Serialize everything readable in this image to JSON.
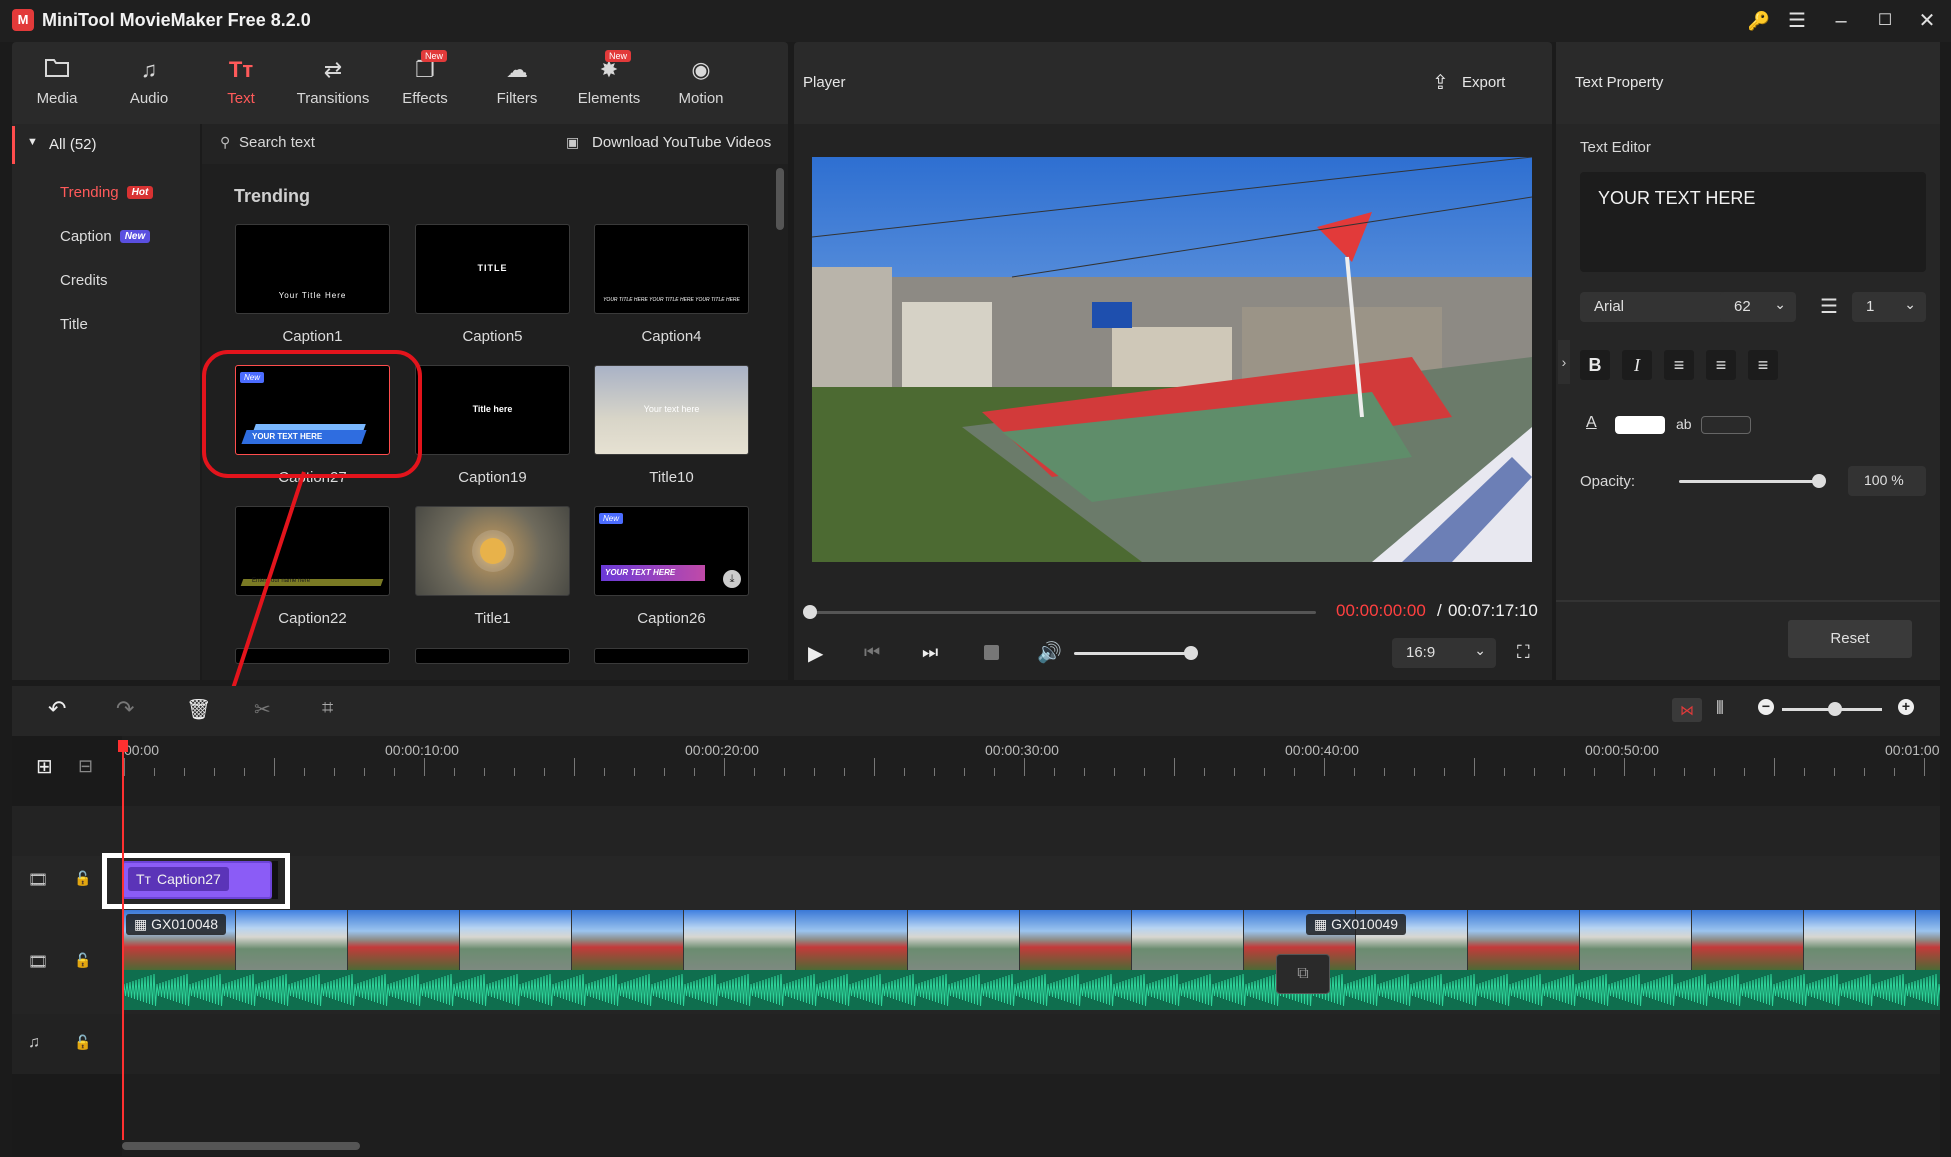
{
  "app": {
    "title": "MiniTool MovieMaker Free 8.2.0"
  },
  "toolbar": {
    "tabs": [
      {
        "label": "Media",
        "icon": "folder-icon"
      },
      {
        "label": "Audio",
        "icon": "music-icon"
      },
      {
        "label": "Text",
        "icon": "text-icon",
        "active": true
      },
      {
        "label": "Transitions",
        "icon": "transitions-icon"
      },
      {
        "label": "Effects",
        "icon": "effects-icon",
        "badge": "New"
      },
      {
        "label": "Filters",
        "icon": "filters-icon"
      },
      {
        "label": "Elements",
        "icon": "elements-icon",
        "badge": "New"
      },
      {
        "label": "Motion",
        "icon": "motion-icon"
      }
    ]
  },
  "sidebar": {
    "all_label": "All (52)",
    "items": [
      {
        "label": "Trending",
        "tag": "Hot",
        "active": true
      },
      {
        "label": "Caption",
        "tag": "New"
      },
      {
        "label": "Credits"
      },
      {
        "label": "Title"
      }
    ]
  },
  "library": {
    "search_placeholder": "Search text",
    "download_label": "Download YouTube Videos",
    "section_title": "Trending",
    "thumbs": [
      {
        "label": "Caption1",
        "preview_text": "Your Title Here"
      },
      {
        "label": "Caption5",
        "preview_text": "TITLE"
      },
      {
        "label": "Caption4",
        "preview_text": "YOUR TITLE HERE YOUR TITLE HERE YOUR TITLE HERE"
      },
      {
        "label": "Caption27",
        "preview_text": "YOUR TEXT HERE",
        "badge": "New"
      },
      {
        "label": "Caption19",
        "preview_text": "Title here"
      },
      {
        "label": "Title10",
        "preview_text": "Your text here"
      },
      {
        "label": "Caption22",
        "preview_text": "Enter your name here"
      },
      {
        "label": "Title1",
        "preview_text": ""
      },
      {
        "label": "Caption26",
        "preview_text": "YOUR TEXT HERE",
        "badge": "New"
      }
    ]
  },
  "player": {
    "title": "Player",
    "export_label": "Export",
    "current_time": "00:00:00:00",
    "separator": "/",
    "total_time": "00:07:17:10",
    "aspect": "16:9",
    "progress": 0,
    "volume": 0.8
  },
  "properties": {
    "title": "Text Property",
    "editor_label": "Text Editor",
    "editor_text": "YOUR TEXT HERE",
    "font": "Arial",
    "size": "62",
    "line_spacing": "1",
    "opacity_label": "Opacity:",
    "opacity_value": "100 %",
    "opacity": 1.0,
    "bg_label": "ab",
    "reset_label": "Reset",
    "colors": {
      "text": "#ffffff",
      "accent": "#ff4d4d"
    }
  },
  "timeline": {
    "ruler": [
      "00:00",
      "00:00:10:00",
      "00:00:20:00",
      "00:00:30:00",
      "00:00:40:00",
      "00:00:50:00",
      "00:01:00"
    ],
    "text_clip": "Caption27",
    "video_clips": [
      "GX010048",
      "GX010049"
    ],
    "zoom": 0.6
  }
}
